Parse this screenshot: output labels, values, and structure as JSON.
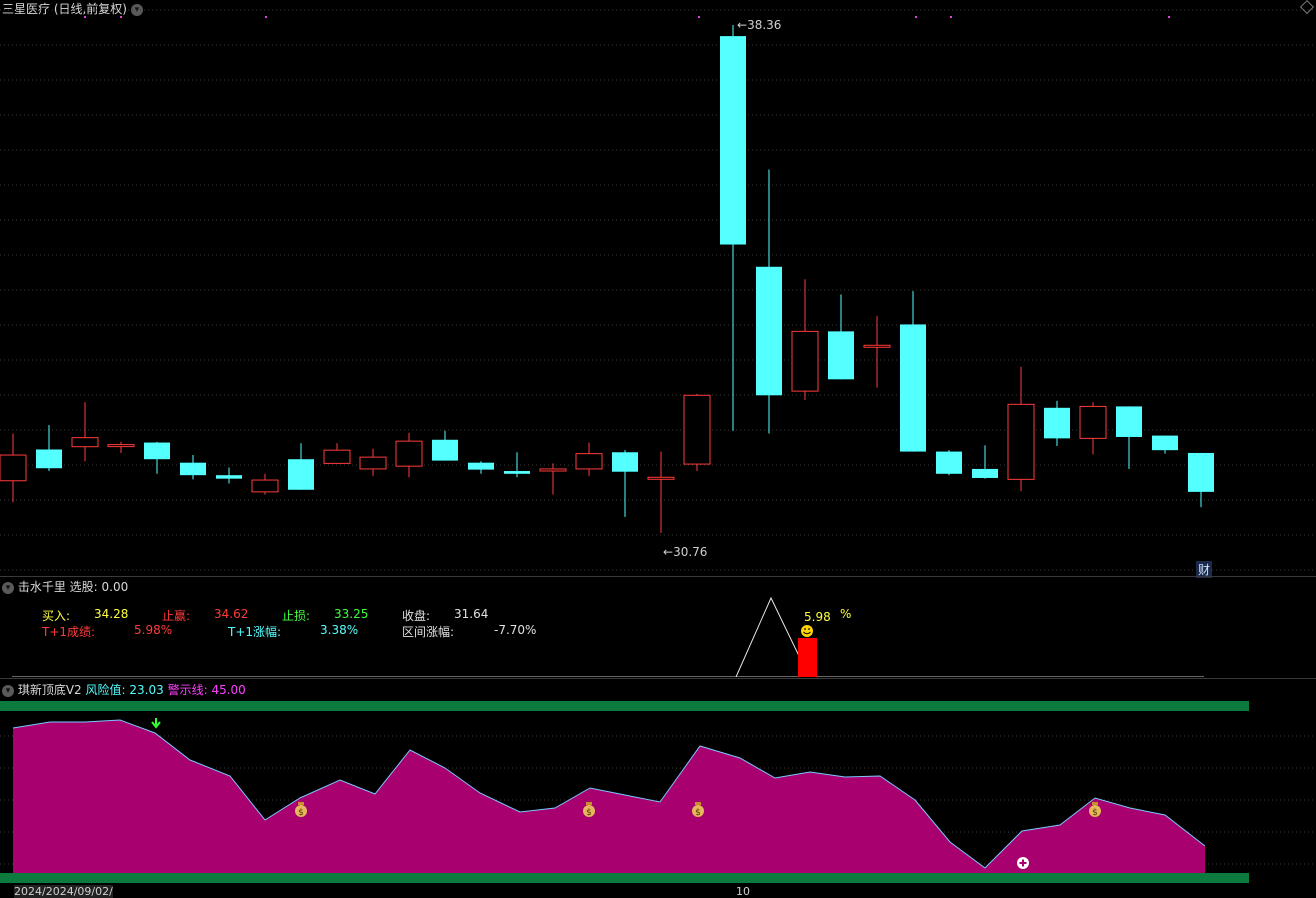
{
  "main_chart": {
    "title": "三星医疗 (日线,前复权)",
    "max_label": "38.36",
    "min_label": "30.76",
    "cai_badge": "财",
    "colors": {
      "up": "#ff3b3b",
      "down": "#54ffff",
      "grid": "#3a3a3a"
    }
  },
  "indicator1": {
    "title": "击水千里",
    "select_label": "选股:",
    "select_value": "0.00",
    "buy_label": "买入:",
    "buy_value": "34.28",
    "take_profit_label": "止赢:",
    "take_profit_value": "34.62",
    "stop_loss_label": "止损:",
    "stop_loss_value": "33.25",
    "close_label": "收盘:",
    "close_value": "31.64",
    "t1_result_label": "T+1成绩:",
    "t1_result_value": "5.98%",
    "t1_change_label": "T+1涨幅:",
    "t1_change_value": "3.38%",
    "range_change_label": "区间涨幅:",
    "range_change_value": "-7.70%",
    "marker_value": "5.98",
    "marker_unit": "%"
  },
  "indicator2": {
    "title": "琪新顶底V2",
    "risk_label": "风险值:",
    "risk_value": "23.03",
    "warn_label": "警示线:",
    "warn_value": "45.00"
  },
  "date_axis": {
    "left_date": "2024/2024/09/02/",
    "mid_label": "10"
  },
  "chart_data": {
    "type": "candlestick",
    "candles": [
      {
        "o": 31.8,
        "h": 32.48,
        "l": 31.49,
        "c": 32.17
      },
      {
        "o": 32.25,
        "h": 32.6,
        "l": 31.94,
        "c": 31.98
      },
      {
        "o": 32.29,
        "h": 32.93,
        "l": 32.08,
        "c": 32.42
      },
      {
        "o": 32.31,
        "h": 32.36,
        "l": 32.2,
        "c": 32.32
      },
      {
        "o": 32.35,
        "h": 32.36,
        "l": 31.9,
        "c": 32.11
      },
      {
        "o": 32.06,
        "h": 32.17,
        "l": 31.82,
        "c": 31.88
      },
      {
        "o": 31.88,
        "h": 31.99,
        "l": 31.76,
        "c": 31.83
      },
      {
        "o": 31.64,
        "h": 31.9,
        "l": 31.6,
        "c": 31.81
      },
      {
        "o": 32.11,
        "h": 32.34,
        "l": 31.8,
        "c": 31.67
      },
      {
        "o": 32.05,
        "h": 32.34,
        "l": 32.14,
        "c": 32.24
      },
      {
        "o": 31.97,
        "h": 32.26,
        "l": 31.87,
        "c": 32.14
      },
      {
        "o": 32.01,
        "h": 32.49,
        "l": 31.85,
        "c": 32.37
      },
      {
        "o": 32.39,
        "h": 32.52,
        "l": 32.1,
        "c": 32.09
      },
      {
        "o": 32.06,
        "h": 32.08,
        "l": 31.9,
        "c": 31.96
      },
      {
        "o": 31.94,
        "h": 32.21,
        "l": 31.85,
        "c": 31.9
      },
      {
        "o": 31.94,
        "h": 32.05,
        "l": 31.6,
        "c": 31.97
      },
      {
        "o": 31.97,
        "h": 32.35,
        "l": 31.87,
        "c": 32.19
      },
      {
        "o": 32.21,
        "h": 32.24,
        "l": 31.28,
        "c": 31.93
      },
      {
        "o": 31.85,
        "h": 32.22,
        "l": 31.05,
        "c": 31.85
      },
      {
        "o": 32.04,
        "h": 33.05,
        "l": 31.94,
        "c": 33.03
      },
      {
        "o": 38.2,
        "h": 38.36,
        "l": 32.52,
        "c": 35.2
      },
      {
        "o": 34.88,
        "h": 36.28,
        "l": 32.48,
        "c": 33.03
      },
      {
        "o": 33.09,
        "h": 34.7,
        "l": 32.96,
        "c": 33.95
      },
      {
        "o": 33.95,
        "h": 34.48,
        "l": 33.65,
        "c": 33.26
      },
      {
        "o": 33.74,
        "h": 34.17,
        "l": 33.14,
        "c": 33.75
      },
      {
        "o": 34.05,
        "h": 34.53,
        "l": 33.13,
        "c": 32.22
      },
      {
        "o": 32.22,
        "h": 32.24,
        "l": 31.88,
        "c": 31.9
      },
      {
        "o": 31.97,
        "h": 32.31,
        "l": 31.83,
        "c": 31.84
      },
      {
        "o": 31.82,
        "h": 33.44,
        "l": 31.65,
        "c": 32.9
      },
      {
        "o": 32.85,
        "h": 32.95,
        "l": 32.3,
        "c": 32.41
      },
      {
        "o": 32.41,
        "h": 32.93,
        "l": 32.18,
        "c": 32.87
      },
      {
        "o": 32.87,
        "h": 32.85,
        "l": 31.97,
        "c": 32.43
      },
      {
        "o": 32.45,
        "h": 32.45,
        "l": 32.19,
        "c": 32.24
      },
      {
        "o": 32.2,
        "h": 31.98,
        "l": 31.42,
        "c": 31.64
      }
    ]
  }
}
